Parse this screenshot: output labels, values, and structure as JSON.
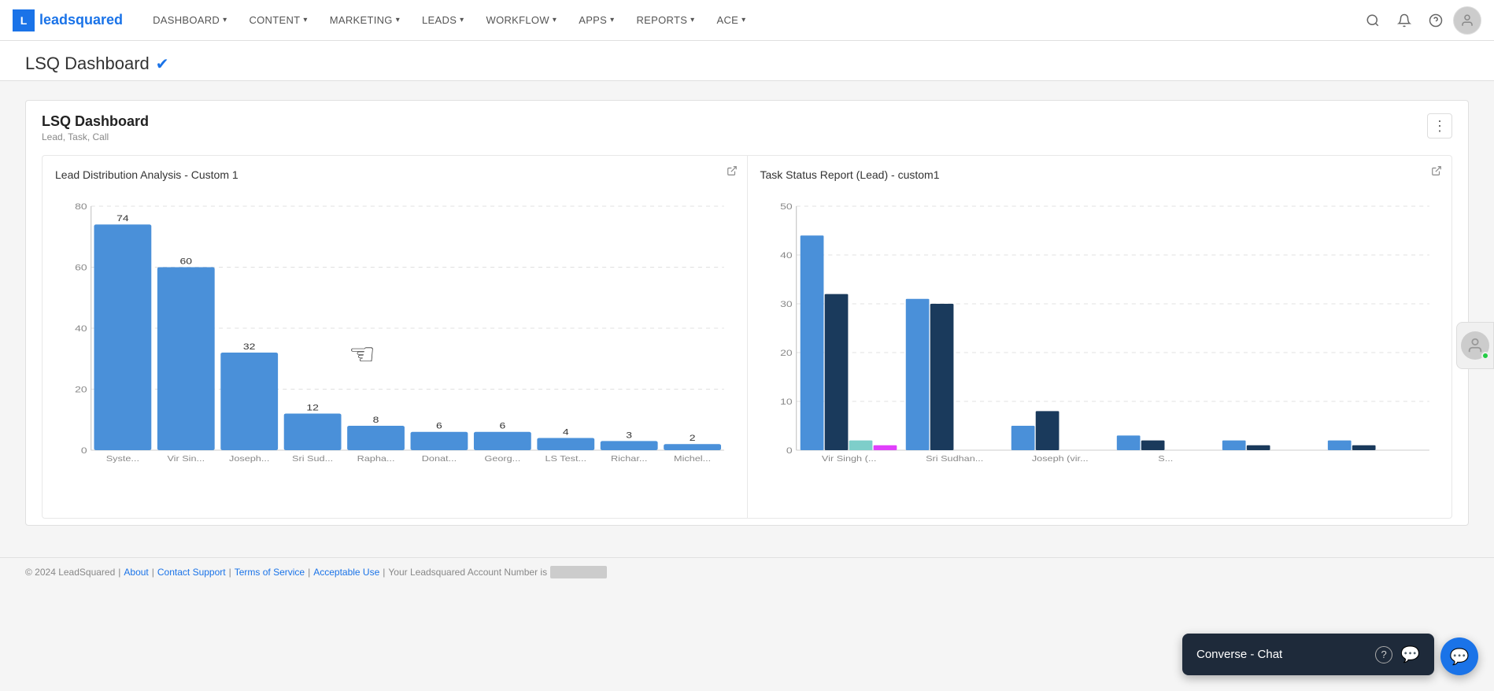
{
  "brand": {
    "logo_letter": "L",
    "name_prefix": "lead",
    "name_suffix": "squared"
  },
  "topnav": {
    "items": [
      {
        "id": "dashboard",
        "label": "DASHBOARD",
        "has_dropdown": true
      },
      {
        "id": "content",
        "label": "CONTENT",
        "has_dropdown": true
      },
      {
        "id": "marketing",
        "label": "MARKETING",
        "has_dropdown": true
      },
      {
        "id": "leads",
        "label": "LEADS",
        "has_dropdown": true
      },
      {
        "id": "workflow",
        "label": "WORKFLOW",
        "has_dropdown": true
      },
      {
        "id": "apps",
        "label": "APPS",
        "has_dropdown": true
      },
      {
        "id": "reports",
        "label": "REPORTS",
        "has_dropdown": true
      },
      {
        "id": "ace",
        "label": "ACE",
        "has_dropdown": true
      }
    ]
  },
  "page": {
    "title": "LSQ Dashboard",
    "subtitle": "Lead, Task, Call",
    "dashboard_title": "LSQ Dashboard"
  },
  "charts": {
    "chart1": {
      "title": "Lead Distribution Analysis - Custom 1",
      "y_labels": [
        "80",
        "60",
        "40",
        "20",
        "0"
      ],
      "bars": [
        {
          "label": "Syste...",
          "value": 74,
          "height_pct": 92
        },
        {
          "label": "Vir Sin...",
          "value": 60,
          "height_pct": 75
        },
        {
          "label": "Joseph...",
          "value": 32,
          "height_pct": 40
        },
        {
          "label": "Sri Sud...",
          "value": 12,
          "height_pct": 15
        },
        {
          "label": "Rapha...",
          "value": 8,
          "height_pct": 10
        },
        {
          "label": "Donat...",
          "value": 6,
          "height_pct": 7.5
        },
        {
          "label": "Georg...",
          "value": 6,
          "height_pct": 7.5
        },
        {
          "label": "LS Test...",
          "value": 4,
          "height_pct": 5
        },
        {
          "label": "Richar...",
          "value": 3,
          "height_pct": 3.75
        },
        {
          "label": "Michel...",
          "value": 2,
          "height_pct": 2.5
        }
      ]
    },
    "chart2": {
      "title": "Task Status Report (Lead) - custom1",
      "y_labels": [
        "50",
        "40",
        "30",
        "20",
        "10",
        "0"
      ],
      "groups": [
        {
          "label": "Vir Singh (...",
          "bars": [
            {
              "value": 44,
              "color": "#4a90d9",
              "height_pct": 88
            },
            {
              "value": 32,
              "color": "#1a3a5c",
              "height_pct": 64
            },
            {
              "value": 2,
              "color": "#7ececa",
              "height_pct": 4
            },
            {
              "value": 1,
              "color": "#e040fb",
              "height_pct": 2
            }
          ]
        },
        {
          "label": "Sri Sudhan...",
          "bars": [
            {
              "value": 31,
              "color": "#4a90d9",
              "height_pct": 62
            },
            {
              "value": 30,
              "color": "#1a3a5c",
              "height_pct": 60
            },
            {
              "value": 0,
              "color": "#7ececa",
              "height_pct": 0
            },
            {
              "value": 0,
              "color": "#e040fb",
              "height_pct": 0
            }
          ]
        },
        {
          "label": "Joseph (vir...",
          "bars": [
            {
              "value": 5,
              "color": "#4a90d9",
              "height_pct": 10
            },
            {
              "value": 8,
              "color": "#1a3a5c",
              "height_pct": 16
            },
            {
              "value": 0,
              "color": "#7ececa",
              "height_pct": 0
            },
            {
              "value": 0,
              "color": "#e040fb",
              "height_pct": 0
            }
          ]
        },
        {
          "label": "S...",
          "bars": [
            {
              "value": 3,
              "color": "#4a90d9",
              "height_pct": 6
            },
            {
              "value": 2,
              "color": "#1a3a5c",
              "height_pct": 4
            },
            {
              "value": 0,
              "color": "#7ececa",
              "height_pct": 0
            },
            {
              "value": 0,
              "color": "#e040fb",
              "height_pct": 0
            }
          ]
        },
        {
          "label": "",
          "bars": [
            {
              "value": 2,
              "color": "#4a90d9",
              "height_pct": 4
            },
            {
              "value": 1,
              "color": "#1a3a5c",
              "height_pct": 2
            },
            {
              "value": 0,
              "color": "#7ececa",
              "height_pct": 0
            },
            {
              "value": 0,
              "color": "#e040fb",
              "height_pct": 0
            }
          ]
        },
        {
          "label": "",
          "bars": [
            {
              "value": 2,
              "color": "#4a90d9",
              "height_pct": 4
            },
            {
              "value": 1,
              "color": "#1a3a5c",
              "height_pct": 2
            },
            {
              "value": 0,
              "color": "#7ececa",
              "height_pct": 0
            },
            {
              "value": 0,
              "color": "#e040fb",
              "height_pct": 0
            }
          ]
        }
      ]
    }
  },
  "footer": {
    "copyright": "© 2024 LeadSquared",
    "links": [
      {
        "id": "about",
        "label": "About"
      },
      {
        "id": "contact-support",
        "label": "Contact Support"
      },
      {
        "id": "terms",
        "label": "Terms of Service"
      },
      {
        "id": "acceptable-use",
        "label": "Acceptable Use"
      }
    ],
    "account_text": "Your Leadsquared Account Number is"
  },
  "converse_chat": {
    "label": "Converse - Chat",
    "question_icon": "?",
    "chat_icon": "💬"
  }
}
